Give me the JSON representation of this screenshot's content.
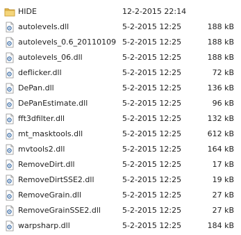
{
  "files": [
    {
      "name": "HIDE",
      "date": "12-2-2015 22:14",
      "size": "",
      "icon": "folder-icon"
    },
    {
      "name": "autolevels.dll",
      "date": "5-2-2015 12:25",
      "size": "188 kB",
      "icon": "dll-file-icon"
    },
    {
      "name": "autolevels_0.6_20110109.dll",
      "date": "5-2-2015 12:25",
      "size": "188 kB",
      "icon": "dll-file-icon"
    },
    {
      "name": "autolevels_06.dll",
      "date": "5-2-2015 12:25",
      "size": "188 kB",
      "icon": "dll-file-icon"
    },
    {
      "name": "deflicker.dll",
      "date": "5-2-2015 12:25",
      "size": "72 kB",
      "icon": "dll-file-icon"
    },
    {
      "name": "DePan.dll",
      "date": "5-2-2015 12:25",
      "size": "136 kB",
      "icon": "dll-file-icon"
    },
    {
      "name": "DePanEstimate.dll",
      "date": "5-2-2015 12:25",
      "size": "96 kB",
      "icon": "dll-file-icon"
    },
    {
      "name": "fft3dfilter.dll",
      "date": "5-2-2015 12:25",
      "size": "132 kB",
      "icon": "dll-file-icon"
    },
    {
      "name": "mt_masktools.dll",
      "date": "5-2-2015 12:25",
      "size": "612 kB",
      "icon": "dll-file-icon"
    },
    {
      "name": "mvtools2.dll",
      "date": "5-2-2015 12:25",
      "size": "164 kB",
      "icon": "dll-file-icon"
    },
    {
      "name": "RemoveDirt.dll",
      "date": "5-2-2015 12:25",
      "size": "17 kB",
      "icon": "dll-file-icon"
    },
    {
      "name": "RemoveDirtSSE2.dll",
      "date": "5-2-2015 12:25",
      "size": "19 kB",
      "icon": "dll-file-icon"
    },
    {
      "name": "RemoveGrain.dll",
      "date": "5-2-2015 12:25",
      "size": "27 kB",
      "icon": "dll-file-icon"
    },
    {
      "name": "RemoveGrainSSE2.dll",
      "date": "5-2-2015 12:25",
      "size": "27 kB",
      "icon": "dll-file-icon"
    },
    {
      "name": "warpsharp.dll",
      "date": "5-2-2015 12:25",
      "size": "184 kB",
      "icon": "dll-file-icon"
    }
  ],
  "colors": {
    "text": "#1e1e1e",
    "folder": "#e8c25a",
    "gear": "#3c6ea8"
  }
}
